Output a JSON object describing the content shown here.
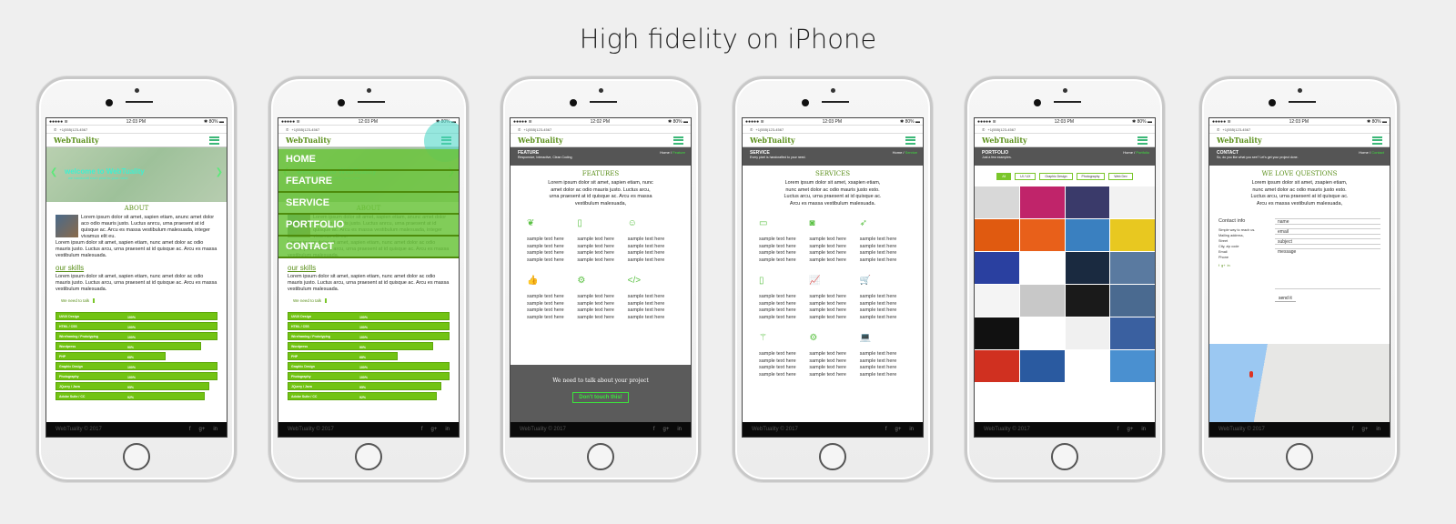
{
  "title": "High fidelity on iPhone",
  "common": {
    "carrier": "●●●●● ≋",
    "battery": "✱ 80% ▬",
    "phone_number": "+1(555)123-4567",
    "logo": "WebTuality",
    "footer_copy": "WebTuality © 2017",
    "social": [
      "f",
      "g+",
      "in"
    ]
  },
  "phones": [
    {
      "time": "12:03 PM",
      "hero_title": "welcome to WebTuality",
      "hero_subtitle": "we handcraft each pixel to your need",
      "about_heading": "ABOUT",
      "about_text_1": "Lorem ipsum dolor sit amet, sapien etiam, anunc amet dolor aco odio mauris justo. Luctus anrcu, urna praesent at id quisque ac. Arcu es massa vestibulum malesuada, integer vivamus elit eu.",
      "about_text_2": "Lorem ipsum dolor sit amet, sapien etiam, nunc amet dolor ac odio mauris justo. Luctus arcu, urna praesent at id quisque ac. Arcu es massa vestibulum malesuada.",
      "skills_heading": "our skills",
      "skills_text": "Lorem ipsum dolor sit amet, sapien etiam, nunc amet dolor ac odio mauris justo. Luctus arcu, urna praesent at id quisque ac. Arcu es massa vestibulum malesuada.",
      "talk_button": "We need to talk",
      "skills": [
        {
          "name": "UI/UX Design",
          "percent": 100
        },
        {
          "name": "HTML / CSS",
          "percent": 100
        },
        {
          "name": "Wireframing / Prototyping",
          "percent": 100
        },
        {
          "name": "Wordpress",
          "percent": 90
        },
        {
          "name": "PHP",
          "percent": 68
        },
        {
          "name": "Graphic Design",
          "percent": 100
        },
        {
          "name": "Photography",
          "percent": 100
        },
        {
          "name": "JQuery / Java",
          "percent": 95
        },
        {
          "name": "Adobe Suite / CC",
          "percent": 92
        }
      ]
    },
    {
      "time": "12:03 PM",
      "menu": [
        "HOME",
        "FEATURE",
        "SERVICE",
        "PORTFOLIO",
        "CONTACT"
      ]
    },
    {
      "time": "12:02 PM",
      "page_title": "FEATURE",
      "page_subtitle": "Responsive, Interactive, Clean Coding",
      "breadcrumb_home": "Home / ",
      "breadcrumb_current": "Feature",
      "heading": "FEATURES",
      "intro": "Lorem ipsum dolor sit amet, sapien etiam, nunc amet dolor ac odio mauris justo. Luctus arcu, urna praesent at id quisque ac. Arcu es massa vestibulum malesuada,",
      "items": [
        {
          "icon": "leaf-icon",
          "glyph": "❦"
        },
        {
          "icon": "mobile-icon",
          "glyph": "▯"
        },
        {
          "icon": "smiley-icon",
          "glyph": "☺"
        },
        {
          "icon": "thumbs-up-icon",
          "glyph": "👍"
        },
        {
          "icon": "gears-icon",
          "glyph": "⚙"
        },
        {
          "icon": "code-icon",
          "glyph": "</>"
        }
      ],
      "sample_text": "sample text here",
      "cta_text": "We need to talk about your project",
      "cta_button": "Don't touch this!"
    },
    {
      "time": "12:03 PM",
      "page_title": "SERVICE",
      "page_subtitle": "Every pixel is handcrafted to your need.",
      "breadcrumb_home": "Home / ",
      "breadcrumb_current": "Service",
      "heading": "SERVICES",
      "intro": "Lorem ipsum dolor sit amet, xsapien etiam, nunc amet dolor ac odio mauris justo esto. Luctus arcu, urna praesent at id quisque ac. Arcu es massa vestibulum malesuada.",
      "items": [
        {
          "icon": "monitor-icon",
          "glyph": "▭"
        },
        {
          "icon": "camera-icon",
          "glyph": "◙"
        },
        {
          "icon": "rocket-icon",
          "glyph": "➶"
        },
        {
          "icon": "mobile-icon",
          "glyph": "▯"
        },
        {
          "icon": "chart-icon",
          "glyph": "📈"
        },
        {
          "icon": "cart-icon",
          "glyph": "🛒"
        },
        {
          "icon": "magic-wand-icon",
          "glyph": "⚚"
        },
        {
          "icon": "gears-icon",
          "glyph": "⚙"
        },
        {
          "icon": "laptop-icon",
          "glyph": "💻"
        }
      ],
      "sample_text": "sample text here"
    },
    {
      "time": "12:03 PM",
      "page_title": "PORTFOLIO",
      "page_subtitle": "Just a few examples.",
      "breadcrumb_home": "Home / ",
      "breadcrumb_current": "Portfolio",
      "filters": [
        "All",
        "UI / UX",
        "Graphic Design",
        "Photography",
        "Web Dev"
      ],
      "active_filter": "All",
      "gallery_colors": [
        "#d8d8d8",
        "#c0246a",
        "#3a3a6a",
        "#f2f2f2",
        "#e05a10",
        "#e8601a",
        "#3a80c0",
        "#e8c820",
        "#2a40a0",
        "#ffffff",
        "#1a2a40",
        "#5a7aa0",
        "#f4f4f4",
        "#c8c8c8",
        "#1a1a1a",
        "#4a6a90",
        "#111111",
        "#ffffff",
        "#f0f0f0",
        "#3a60a0",
        "#d03020",
        "#2a5aa0",
        "#ffffff",
        "#4a90d0"
      ]
    },
    {
      "time": "12:03 PM",
      "page_title": "CONTACT",
      "page_subtitle": "So, do you like what you see? Let's get your project done.",
      "breadcrumb_home": "Home / ",
      "breadcrumb_current": "Contact",
      "heading": "WE LOVE QUESTIONS",
      "intro": "Lorem ipsum dolor sit amet, zsapien etiam, nunc amet dolor ac odio mauris justo esto. Luctus arcu, urna praesent at id quisque ac. Arcu es massa vestibulum malesuada,",
      "contact_info_title": "Contact info",
      "contact_info_lines": [
        "Simple way to reach us.",
        "Mailing address,",
        "Street",
        "City, zip code",
        "Email",
        "Phone"
      ],
      "form_name": "name",
      "form_email": "email",
      "form_subject": "subject",
      "form_message": "message",
      "send_button": "send it"
    }
  ]
}
